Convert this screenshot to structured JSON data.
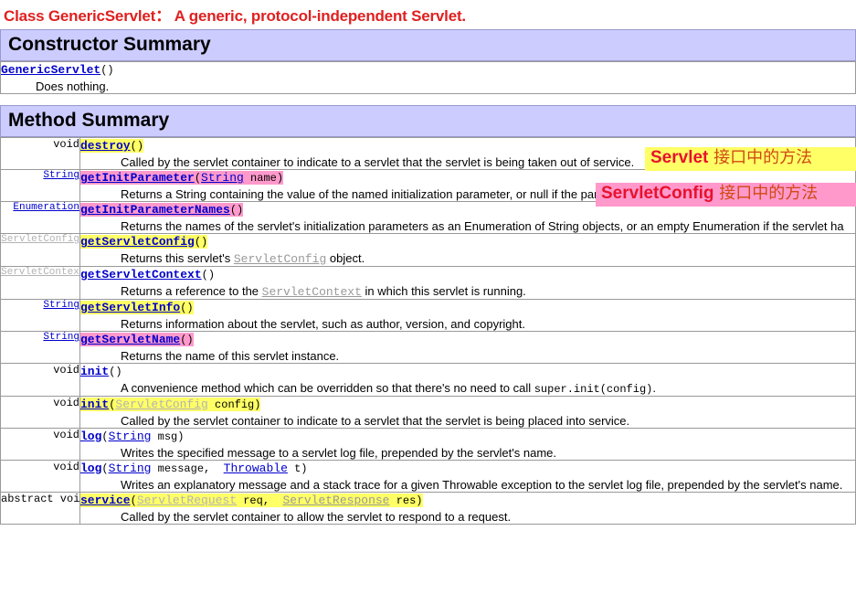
{
  "page": {
    "title": "Class GenericServlet：  A generic, protocol-independent Servlet."
  },
  "constructor_summary": {
    "banner": "Constructor Summary",
    "entries": [
      {
        "name": "GenericServlet",
        "args": "()",
        "description": "Does nothing."
      }
    ]
  },
  "method_summary": {
    "banner": "Method Summary",
    "rows": [
      {
        "type": "void",
        "type_style": "plain",
        "name": "destroy",
        "highlight": "yellow",
        "sig_parts": [
          {
            "t": "(",
            "k": "code"
          },
          {
            "t": ")",
            "k": "code"
          }
        ],
        "sig_text": "()",
        "description": "Called by the servlet container to indicate to a servlet that the servlet is being taken out of service."
      },
      {
        "type": "String",
        "type_style": "link",
        "name": "getInitParameter",
        "highlight": "pink",
        "sig_text": "(String name)",
        "description": "Returns a String containing the value of the named initialization parameter, or null if the parameter does not exist."
      },
      {
        "type": "Enumeration",
        "type_style": "link",
        "name": "getInitParameterNames",
        "highlight": "pink",
        "sig_text": "()",
        "description": "Returns the names of the servlet's initialization parameters as an Enumeration of String objects, or an empty Enumeration if the servlet ha"
      },
      {
        "type": "ServletConfig",
        "type_style": "dim",
        "name": "getServletConfig",
        "highlight": "yellow",
        "sig_text": "()",
        "description": "Returns this servlet's ServletConfig object."
      },
      {
        "type": "ServletContext",
        "type_style": "dim",
        "name": "getServletContext",
        "highlight": "none",
        "sig_text": "()",
        "description": "Returns a reference to the ServletContext in which this servlet is running."
      },
      {
        "type": "String",
        "type_style": "link",
        "name": "getServletInfo",
        "highlight": "yellow",
        "sig_text": "()",
        "description": "Returns information about the servlet, such as author, version, and copyright."
      },
      {
        "type": "String",
        "type_style": "link",
        "name": "getServletName",
        "highlight": "pink",
        "sig_text": "()",
        "description": "Returns the name of this servlet instance."
      },
      {
        "type": "void",
        "type_style": "plain",
        "name": "init",
        "highlight": "none",
        "sig_text": "()",
        "description": "A convenience method which can be overridden so that there's no need to call super.init(config)."
      },
      {
        "type": "void",
        "type_style": "plain",
        "name": "init",
        "highlight": "yellow",
        "sig_text": "(ServletConfig config)",
        "description": "Called by the servlet container to indicate to a servlet that the servlet is being placed into service."
      },
      {
        "type": "void",
        "type_style": "plain",
        "name": "log",
        "highlight": "none",
        "sig_text": "(String msg)",
        "description": "Writes the specified message to a servlet log file, prepended by the servlet's name."
      },
      {
        "type": "void",
        "type_style": "plain",
        "name": "log",
        "highlight": "none",
        "sig_text": "(String message, Throwable t)",
        "description": "Writes an explanatory message and a stack trace for a given Throwable exception to the servlet log file, prepended by the servlet's name."
      },
      {
        "type": "abstract  void",
        "type_style": "plain",
        "name": "service",
        "highlight": "yellow",
        "sig_text": "(ServletRequest req, ServletResponse res)",
        "description": "Called by the servlet container to allow the servlet to respond to a request."
      }
    ]
  },
  "annotations": [
    {
      "id": "annot-servlet",
      "english": "Servlet",
      "chinese": " 接口中的方法",
      "background": "#ffff66"
    },
    {
      "id": "annot-servletconfig",
      "english": "ServletConfig",
      "chinese": " 接口中的方法",
      "background": "#ff99cc"
    }
  ],
  "tokens": {
    "paren_open": "(",
    "paren_close": ")",
    "comma": ", ",
    "String": "String",
    "Enumeration": "Enumeration",
    "Throwable": "Throwable",
    "ServletConfig": "ServletConfig",
    "ServletContext": "ServletContext",
    "ServletRequest": "ServletRequest",
    "ServletResponse": "ServletResponse",
    "arg_name": "name",
    "arg_config": "config",
    "arg_msg": "msg",
    "arg_message": "message",
    "arg_t": "t",
    "arg_req": "req",
    "arg_res": "res",
    "super_init": "super.init(config)",
    "null": "null",
    "object_word": "object."
  },
  "colors": {
    "title_red": "#e02020",
    "banner_bg": "#ccccff",
    "banner_border": "#9999cc",
    "highlight_yellow": "#ffff66",
    "highlight_pink": "#ff99cc",
    "link_blue": "#0000cc",
    "dim_gray": "#b3b3b3",
    "annotation_en_red": "#e8112d",
    "annotation_cn_orange": "#d04a12"
  }
}
